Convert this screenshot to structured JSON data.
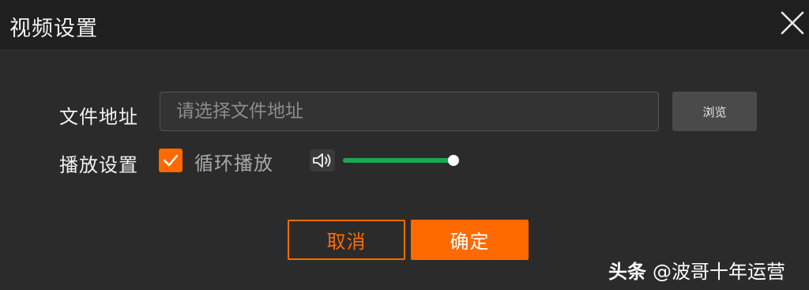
{
  "dialog": {
    "title": "视频设置",
    "close_icon": "close-icon"
  },
  "file_row": {
    "label": "文件地址",
    "input_value": "",
    "input_placeholder": "请选择文件地址",
    "browse_label": "浏览"
  },
  "play_row": {
    "label": "播放设置",
    "loop_checked": true,
    "loop_label": "循环播放",
    "volume_icon": "speaker-icon",
    "volume_level": 1.0
  },
  "actions": {
    "cancel_label": "取消",
    "ok_label": "确定"
  },
  "watermark": {
    "brand": "头条",
    "handle": "@波哥十年运营"
  },
  "colors": {
    "accent": "#ff6a00",
    "slider_fill": "#1aa94f",
    "background": "#2b2b2b",
    "titlebar": "#1f1f1f"
  }
}
